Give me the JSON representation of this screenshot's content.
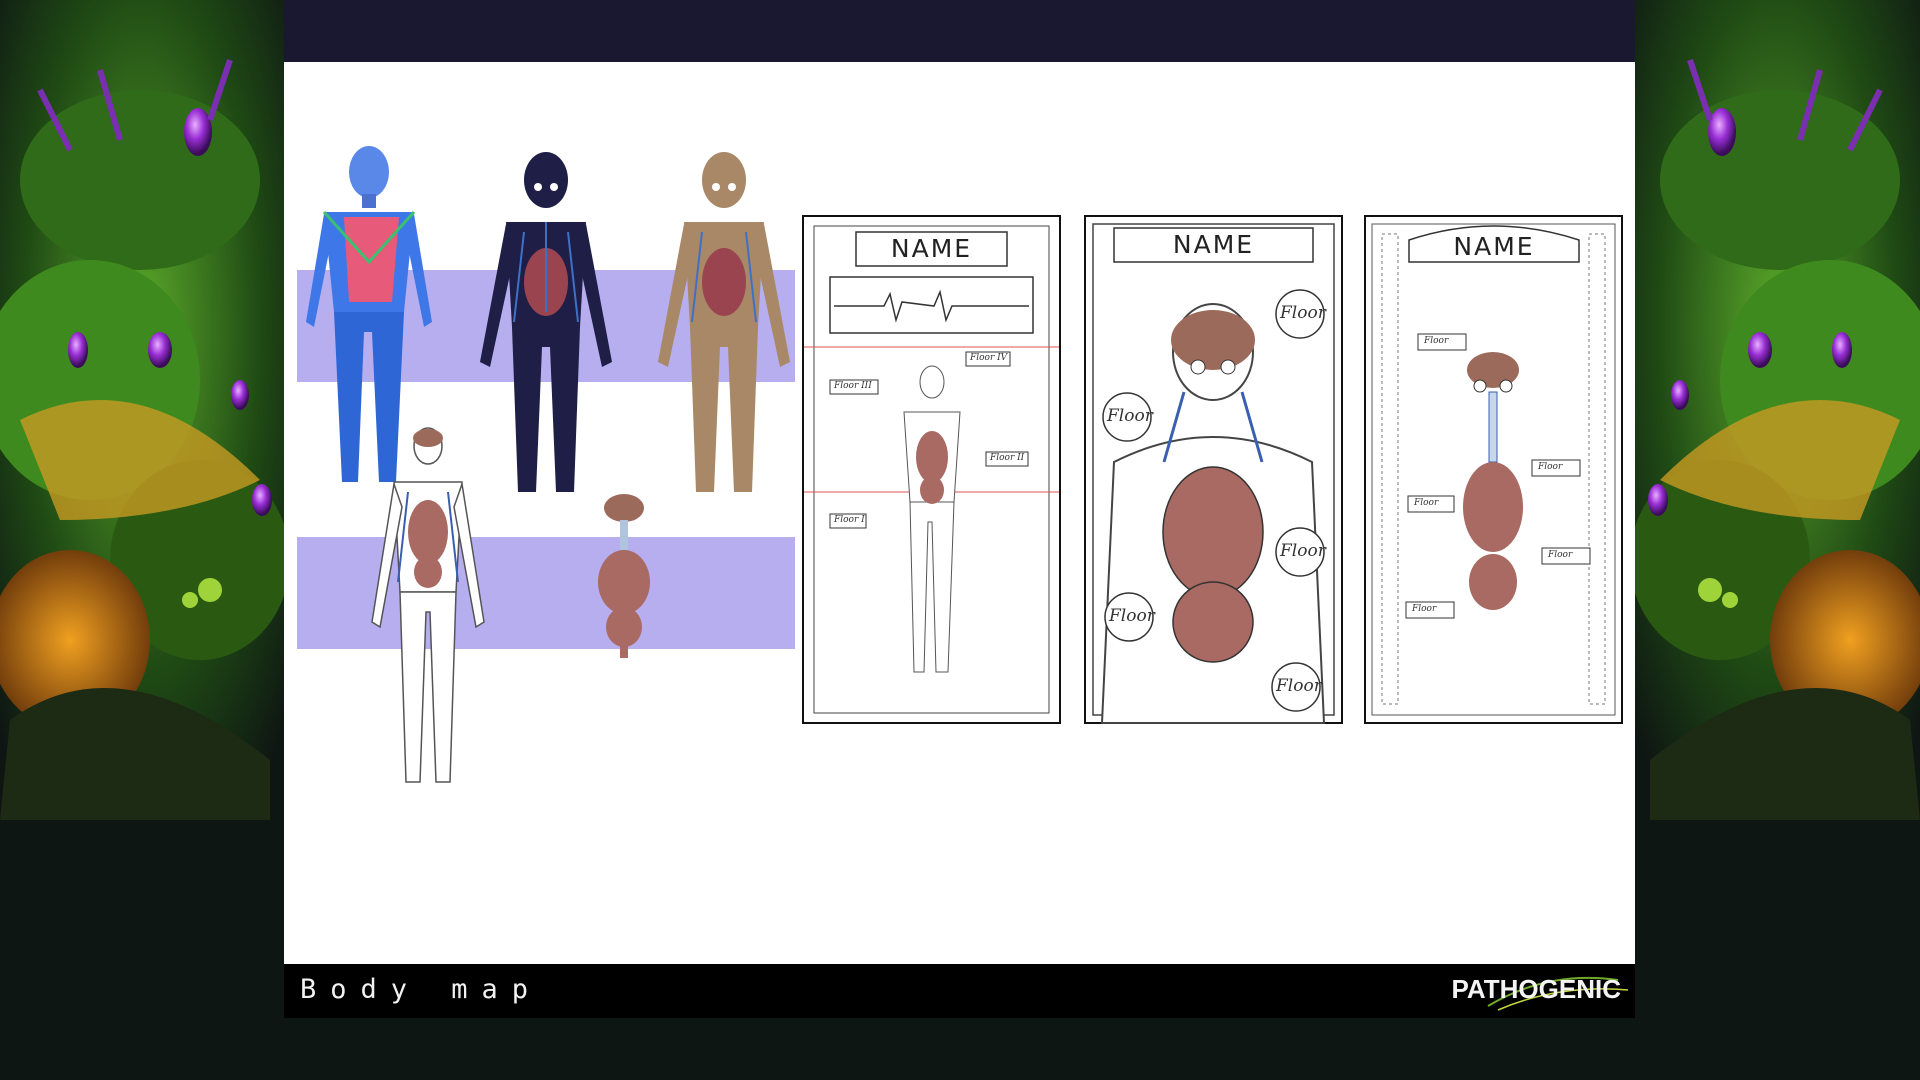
{
  "slide": {
    "title": "Body map",
    "logo_text": "PATHOGENIC",
    "colors": {
      "background": "#0e1613",
      "slide": "#ffffff",
      "footer": "#000000",
      "band": "#b7aef0",
      "organ": "#a86a62",
      "vein": "#3a5fb0",
      "glow": "#c040ff",
      "foliage": "#3f8a1e"
    }
  },
  "cards": [
    {
      "name": "NAME",
      "labels": [
        "Floor IV",
        "Floor III",
        "Floor II",
        "Floor I"
      ]
    },
    {
      "name": "NAME",
      "labels": [
        "Floor",
        "Floor",
        "Floor",
        "Floor",
        "Floor"
      ]
    },
    {
      "name": "NAME",
      "labels": [
        "Floor",
        "Floor",
        "Floor",
        "Floor",
        "Floor"
      ]
    }
  ]
}
